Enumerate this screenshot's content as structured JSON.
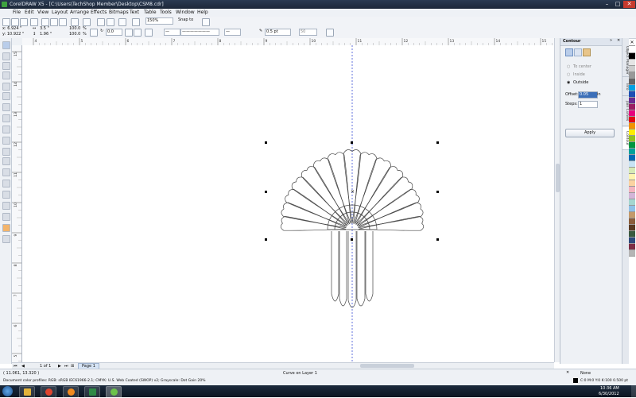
{
  "window": {
    "title": "CorelDRAW X5 - [C:\\Users\\TechShop Member\\Desktop\\CSM8.cdr]"
  },
  "menu": [
    "File",
    "Edit",
    "View",
    "Layout",
    "Arrange",
    "Effects",
    "Bitmaps",
    "Text",
    "Table",
    "Tools",
    "Window",
    "Help"
  ],
  "standard_toolbar": {
    "zoom": "150%",
    "snap_to": "Snap to"
  },
  "property_bar": {
    "x": "x: 6.924 \"",
    "y": "y: 10.922 \"",
    "width": "3.5 \"",
    "height": "1.96 \"",
    "scale_w": "100.0",
    "scale_h": "100.0",
    "pct": "%",
    "rotation": "0.0",
    "outline_width": "0.5 pt",
    "smoothing": "50"
  },
  "rulers": {
    "horizontal": [
      "4",
      "5",
      "6",
      "7",
      "8",
      "9",
      "10",
      "11",
      "12",
      "13",
      "14",
      "15"
    ],
    "vertical": [
      "15",
      "14",
      "13",
      "12",
      "11",
      "10",
      "9",
      "8",
      "7",
      "6",
      "5"
    ],
    "unit": "inches"
  },
  "docker": {
    "title": "Contour",
    "options": [
      {
        "label": "To center",
        "selected": false
      },
      {
        "label": "Inside",
        "selected": false
      },
      {
        "label": "Outside",
        "selected": true
      }
    ],
    "offset_label": "Offset:",
    "offset_value": "0.05",
    "offset_unit": "in",
    "steps_label": "Steps:",
    "steps_value": "1",
    "apply": "Apply",
    "side_tabs": [
      "Object Manager",
      "Info",
      "Join Curves",
      "Contour"
    ]
  },
  "page_nav": {
    "counter": "1 of 1",
    "page_tab": "Page 1"
  },
  "status": {
    "coords": "( 11.061, 13.320 )",
    "object": "Curve on Layer 1",
    "fill": "None",
    "outline": "C:0 M:0 Y:0 K:100  0.500 pt",
    "profiles": "Document color profiles: RGB: sRGB IEC61966-2.1; CMYK: U.S. Web Coated (SWOP) v2; Grayscale: Dot Gain 20%"
  },
  "taskbar": {
    "time": "10:36 AM",
    "date": "6/30/2012"
  },
  "palette": [
    "#ffffff",
    "#000000",
    "#e5e5e5",
    "#cccccc",
    "#999999",
    "#666666",
    "#00a0e3",
    "#1e4fb4",
    "#6a2c91",
    "#9b1f63",
    "#e6007e",
    "#e30613",
    "#f39200",
    "#ffed00",
    "#95c11f",
    "#009640",
    "#00a19a",
    "#0069b4",
    "#c8e3f5",
    "#d6eab5",
    "#fff4b0",
    "#fbd3a1",
    "#f4b4c0",
    "#d4b5d8",
    "#a5d6cf",
    "#8fc1e8",
    "#c39a6b",
    "#8b5e3c",
    "#5a3a22",
    "#3a5a40",
    "#2e4a7d",
    "#7d2e46",
    "#b5b5b5"
  ],
  "colors": {
    "guide": "#3b4fd6",
    "accent": "#3c6fb8"
  }
}
